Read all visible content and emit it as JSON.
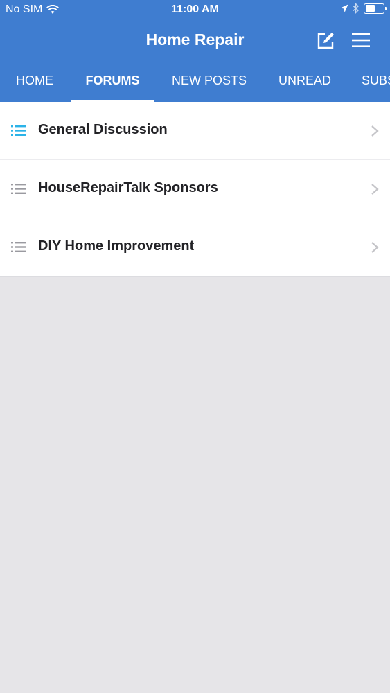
{
  "status_bar": {
    "carrier": "No SIM",
    "time": "11:00 AM",
    "icons": [
      "wifi-icon",
      "location-arrow-icon",
      "bluetooth-icon",
      "battery-icon"
    ],
    "battery_level": 0.55
  },
  "header": {
    "title": "Home Repair",
    "compose_icon": "compose-icon",
    "menu_icon": "hamburger-menu-icon"
  },
  "tabs": [
    {
      "label": "HOME",
      "active": false
    },
    {
      "label": "FORUMS",
      "active": true
    },
    {
      "label": "NEW POSTS",
      "active": false
    },
    {
      "label": "UNREAD",
      "active": false
    },
    {
      "label": "SUBS",
      "active": false
    }
  ],
  "forums": [
    {
      "label": "General Discussion",
      "icon": "list-icon",
      "highlighted": true
    },
    {
      "label": "HouseRepairTalk Sponsors",
      "icon": "list-icon",
      "highlighted": false
    },
    {
      "label": "DIY Home Improvement",
      "icon": "list-icon",
      "highlighted": false
    }
  ],
  "colors": {
    "header_bg": "#3f7dd0",
    "accent_icon": "#2bb3e8",
    "muted_icon": "#9a9aa0",
    "page_bg": "#e6e5e8"
  }
}
